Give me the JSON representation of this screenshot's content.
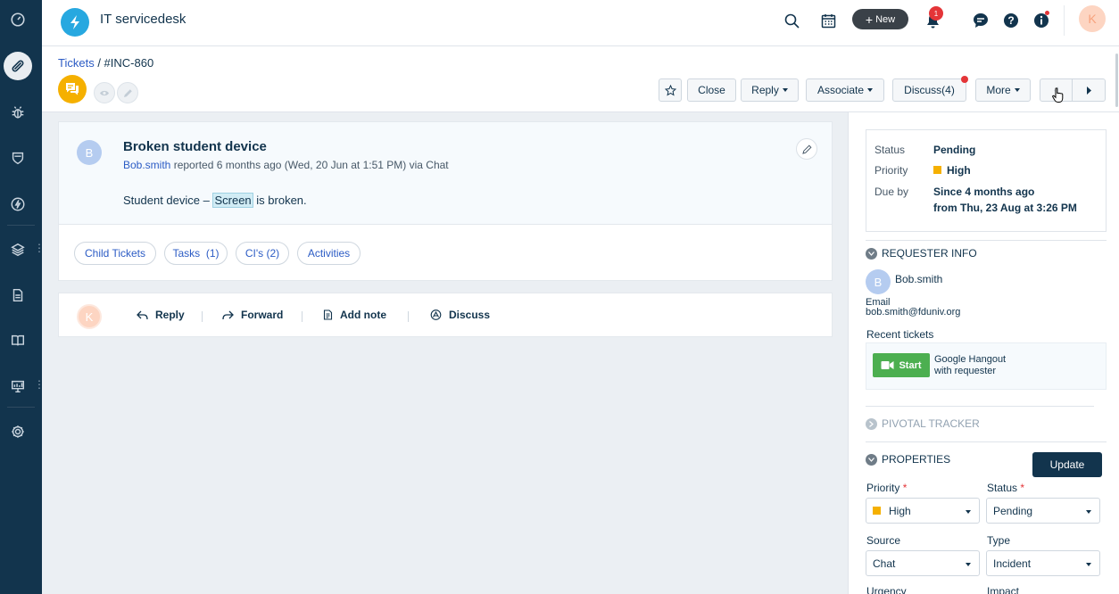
{
  "app": {
    "title": "IT servicedesk"
  },
  "topbar": {
    "new_label": "New",
    "notification_count": "1",
    "avatar_initial": "K"
  },
  "breadcrumb": {
    "parent": "Tickets",
    "separator": " / ",
    "current": "#INC-860"
  },
  "toolbar": {
    "close": "Close",
    "reply": "Reply",
    "associate": "Associate",
    "discuss": "Discuss(4)",
    "more": "More"
  },
  "ticket": {
    "subject": "Broken student device",
    "requester_initial": "B",
    "requester": "Bob.smith",
    "reported_text": " reported 6 months ago (Wed, 20 Jun at 1:51 PM) via Chat",
    "desc_prefix": "Student device – ",
    "desc_highlight": "Screen",
    "desc_suffix": " is broken.",
    "tabs": [
      {
        "label": "Child Tickets"
      },
      {
        "label": "Tasks  (1)"
      },
      {
        "label": "CI's (2)"
      },
      {
        "label": "Activities"
      }
    ]
  },
  "reply_bar": {
    "avatar_initial": "K",
    "actions": [
      {
        "label": "Reply",
        "icon": "reply-icon"
      },
      {
        "label": "Forward",
        "icon": "forward-icon"
      },
      {
        "label": "Add note",
        "icon": "note-icon"
      },
      {
        "label": "Discuss",
        "icon": "discuss-icon"
      }
    ]
  },
  "status_box": {
    "status_label": "Status",
    "status_value": "Pending",
    "priority_label": "Priority",
    "priority_value": "High",
    "due_label": "Due by",
    "due_line1": "Since 4 months ago",
    "due_line2": "from Thu, 23 Aug at 3:26 PM"
  },
  "requester_info": {
    "heading": "REQUESTER INFO",
    "initial": "B",
    "name": "Bob.smith",
    "email_label": "Email",
    "email": "bob.smith@fduniv.org",
    "recent_tickets": "Recent tickets",
    "hangout_start": "Start",
    "hangout_line1": "Google Hangout",
    "hangout_line2": "with requester"
  },
  "pivotal": {
    "heading": "PIVOTAL TRACKER"
  },
  "properties": {
    "heading": "PROPERTIES",
    "update": "Update",
    "priority_label": "Priority",
    "priority_value": "High",
    "status_label": "Status",
    "status_value": "Pending",
    "source_label": "Source",
    "source_value": "Chat",
    "type_label": "Type",
    "type_value": "Incident",
    "urgency_label": "Urgency",
    "impact_label": "Impact"
  },
  "colors": {
    "accent": "#2c5cc5",
    "rail": "#12344d",
    "priority_high": "#f5b000",
    "alert": "#e43538"
  }
}
